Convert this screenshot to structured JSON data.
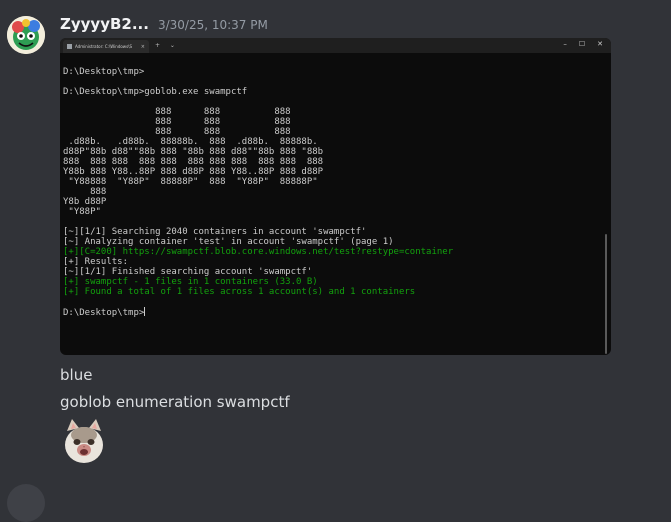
{
  "message": {
    "username": "ZyyyyB2...",
    "timestamp": "3/30/25, 10:37 PM",
    "avatar_icon": "colorful-cartoon-avatar",
    "text_lines": [
      "blue",
      "goblob enumeration swampctf"
    ],
    "sticker_icon": "cat-meme-sticker"
  },
  "terminal_window": {
    "tab_title": "Administrator: C:\\Windows\\S",
    "tab_close": "×",
    "tab_actions": "+ ⌄",
    "controls": {
      "minimize": "–",
      "maximize": "☐",
      "close": "✕"
    },
    "background": "#0c0c0c",
    "text_color": "#cccccc",
    "green_color": "#13a10e"
  },
  "terminal": {
    "lines": [
      {
        "text": "",
        "color": "default"
      },
      {
        "text": "D:\\Desktop\\tmp>",
        "color": "default"
      },
      {
        "text": "",
        "color": "default"
      },
      {
        "text": "D:\\Desktop\\tmp>goblob.exe swampctf",
        "color": "default"
      },
      {
        "text": "",
        "color": "default"
      },
      {
        "text": "                 888      888          888",
        "color": "default"
      },
      {
        "text": "                 888      888          888",
        "color": "default"
      },
      {
        "text": "                 888      888          888",
        "color": "default"
      },
      {
        "text": " .d88b.   .d88b.  88888b.  888  .d88b.  88888b.",
        "color": "default"
      },
      {
        "text": "d88P\"88b d88\"\"88b 888 \"88b 888 d88\"\"88b 888 \"88b",
        "color": "default"
      },
      {
        "text": "888  888 888  888 888  888 888 888  888 888  888",
        "color": "default"
      },
      {
        "text": "Y88b 888 Y88..88P 888 d88P 888 Y88..88P 888 d88P",
        "color": "default"
      },
      {
        "text": " \"Y88888  \"Y88P\"  88888P\"  888  \"Y88P\"  88888P\"",
        "color": "default"
      },
      {
        "text": "     888",
        "color": "default"
      },
      {
        "text": "Y8b d88P",
        "color": "default"
      },
      {
        "text": " \"Y88P\"",
        "color": "default"
      },
      {
        "text": "",
        "color": "default"
      },
      {
        "text": "[~][1/1] Searching 2040 containers in account 'swampctf'",
        "color": "default"
      },
      {
        "text": "[~] Analyzing container 'test' in account 'swampctf' (page 1)",
        "color": "default"
      },
      {
        "text": "[+][C=200] https://swampctf.blob.core.windows.net/test?restype=container",
        "color": "green"
      },
      {
        "text": "[+] Results:",
        "color": "default"
      },
      {
        "text": "[~][1/1] Finished searching account 'swampctf'",
        "color": "default"
      },
      {
        "text": "[+] swampctf - 1 files in 1 containers (33.0 B)",
        "color": "green"
      },
      {
        "text": "[+] Found a total of 1 files across 1 account(s) and 1 containers",
        "color": "green"
      },
      {
        "text": "",
        "color": "default"
      },
      {
        "text": "D:\\Desktop\\tmp>",
        "color": "default",
        "cursor": true
      }
    ]
  }
}
